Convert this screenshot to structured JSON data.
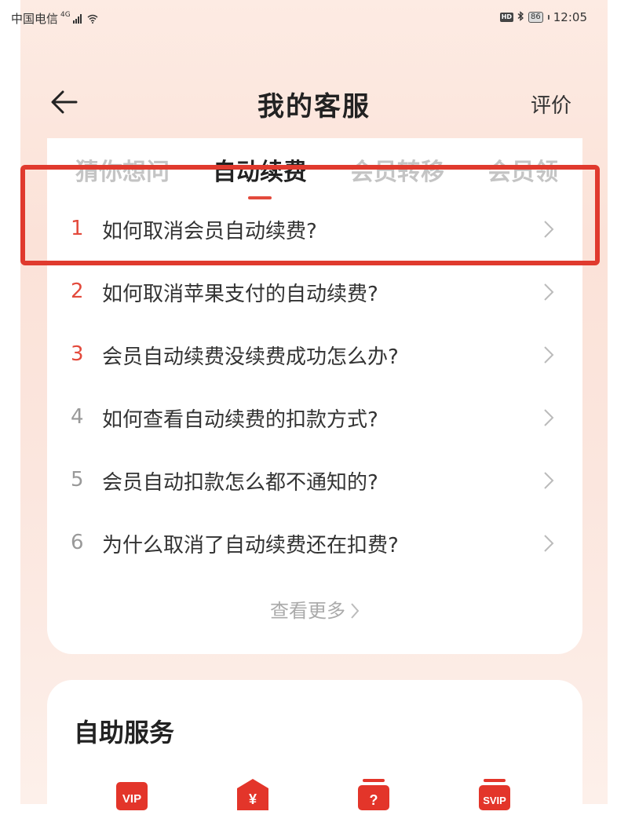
{
  "status_bar": {
    "carrier": "中国电信",
    "network": "4G",
    "battery": "86",
    "time": "12:05",
    "hd_label": "HD"
  },
  "header": {
    "title": "我的客服",
    "rate_label": "评价",
    "back_icon": "arrow-left-icon"
  },
  "tabs": [
    {
      "label": "猜你想问",
      "active": false
    },
    {
      "label": "自动续费",
      "active": true
    },
    {
      "label": "会员转移",
      "active": false
    },
    {
      "label": "会员领",
      "active": false
    }
  ],
  "faq": {
    "items": [
      {
        "num": "1",
        "text": "如何取消会员自动续费?",
        "hot": true
      },
      {
        "num": "2",
        "text": "如何取消苹果支付的自动续费?",
        "hot": true
      },
      {
        "num": "3",
        "text": "会员自动续费没续费成功怎么办?",
        "hot": true
      },
      {
        "num": "4",
        "text": "如何查看自动续费的扣款方式?",
        "hot": false
      },
      {
        "num": "5",
        "text": "会员自动扣款怎么都不通知的?",
        "hot": false
      },
      {
        "num": "6",
        "text": "为什么取消了自动续费还在扣费?",
        "hot": false
      }
    ],
    "more_label": "查看更多"
  },
  "service": {
    "title": "自助服务",
    "icons": [
      {
        "label": "VIP",
        "icon": "vip-icon"
      },
      {
        "label": "¥",
        "icon": "yuan-icon"
      },
      {
        "label": "?",
        "icon": "question-icon"
      },
      {
        "label": "SVIP",
        "icon": "svip-icon"
      }
    ]
  },
  "colors": {
    "accent": "#e34a3c",
    "highlight_box": "#e03a2e",
    "background": "#fbe4da"
  }
}
